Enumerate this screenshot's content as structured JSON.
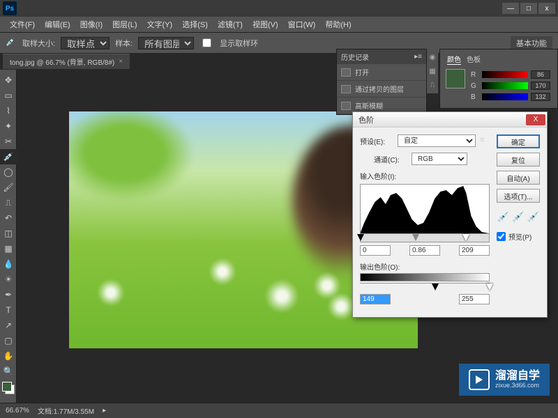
{
  "app": {
    "logo": "Ps"
  },
  "window_controls": {
    "min": "—",
    "max": "□",
    "close": "x"
  },
  "menu": [
    "文件(F)",
    "编辑(E)",
    "图像(I)",
    "图层(L)",
    "文字(Y)",
    "选择(S)",
    "滤镜(T)",
    "视图(V)",
    "窗口(W)",
    "帮助(H)"
  ],
  "toolbar": {
    "sample_size_label": "取样大小:",
    "sample_size_value": "取样点",
    "sample_label": "样本:",
    "sample_value": "所有图层",
    "show_ring": "显示取样环",
    "mode_label": "基本功能"
  },
  "doc_tab": "tong.jpg @ 66.7% (背景, RGB/8#)",
  "history": {
    "title": "历史记录",
    "items": [
      "打开",
      "通过拷贝的图层",
      "高斯模糊"
    ]
  },
  "color_panel": {
    "tabs": [
      "颜色",
      "色板"
    ],
    "r": "86",
    "g": "170",
    "b": "132"
  },
  "dialog": {
    "title": "色阶",
    "preset_label": "预设(E):",
    "preset_value": "自定",
    "channel_label": "通道(C):",
    "channel_value": "RGB",
    "input_label": "输入色阶(I):",
    "shadow": "0",
    "mid": "0.86",
    "highlight": "209",
    "output_label": "输出色阶(O):",
    "out_black": "149",
    "out_white": "255",
    "ok": "确定",
    "cancel": "复位",
    "auto": "自动(A)",
    "options": "选项(T)...",
    "preview": "预览(P)"
  },
  "status": {
    "zoom": "66.67%",
    "doc_info": "文档:1.77M/3.55M"
  },
  "watermark": {
    "main": "溜溜自学",
    "sub": "zixue.3d66.com"
  }
}
